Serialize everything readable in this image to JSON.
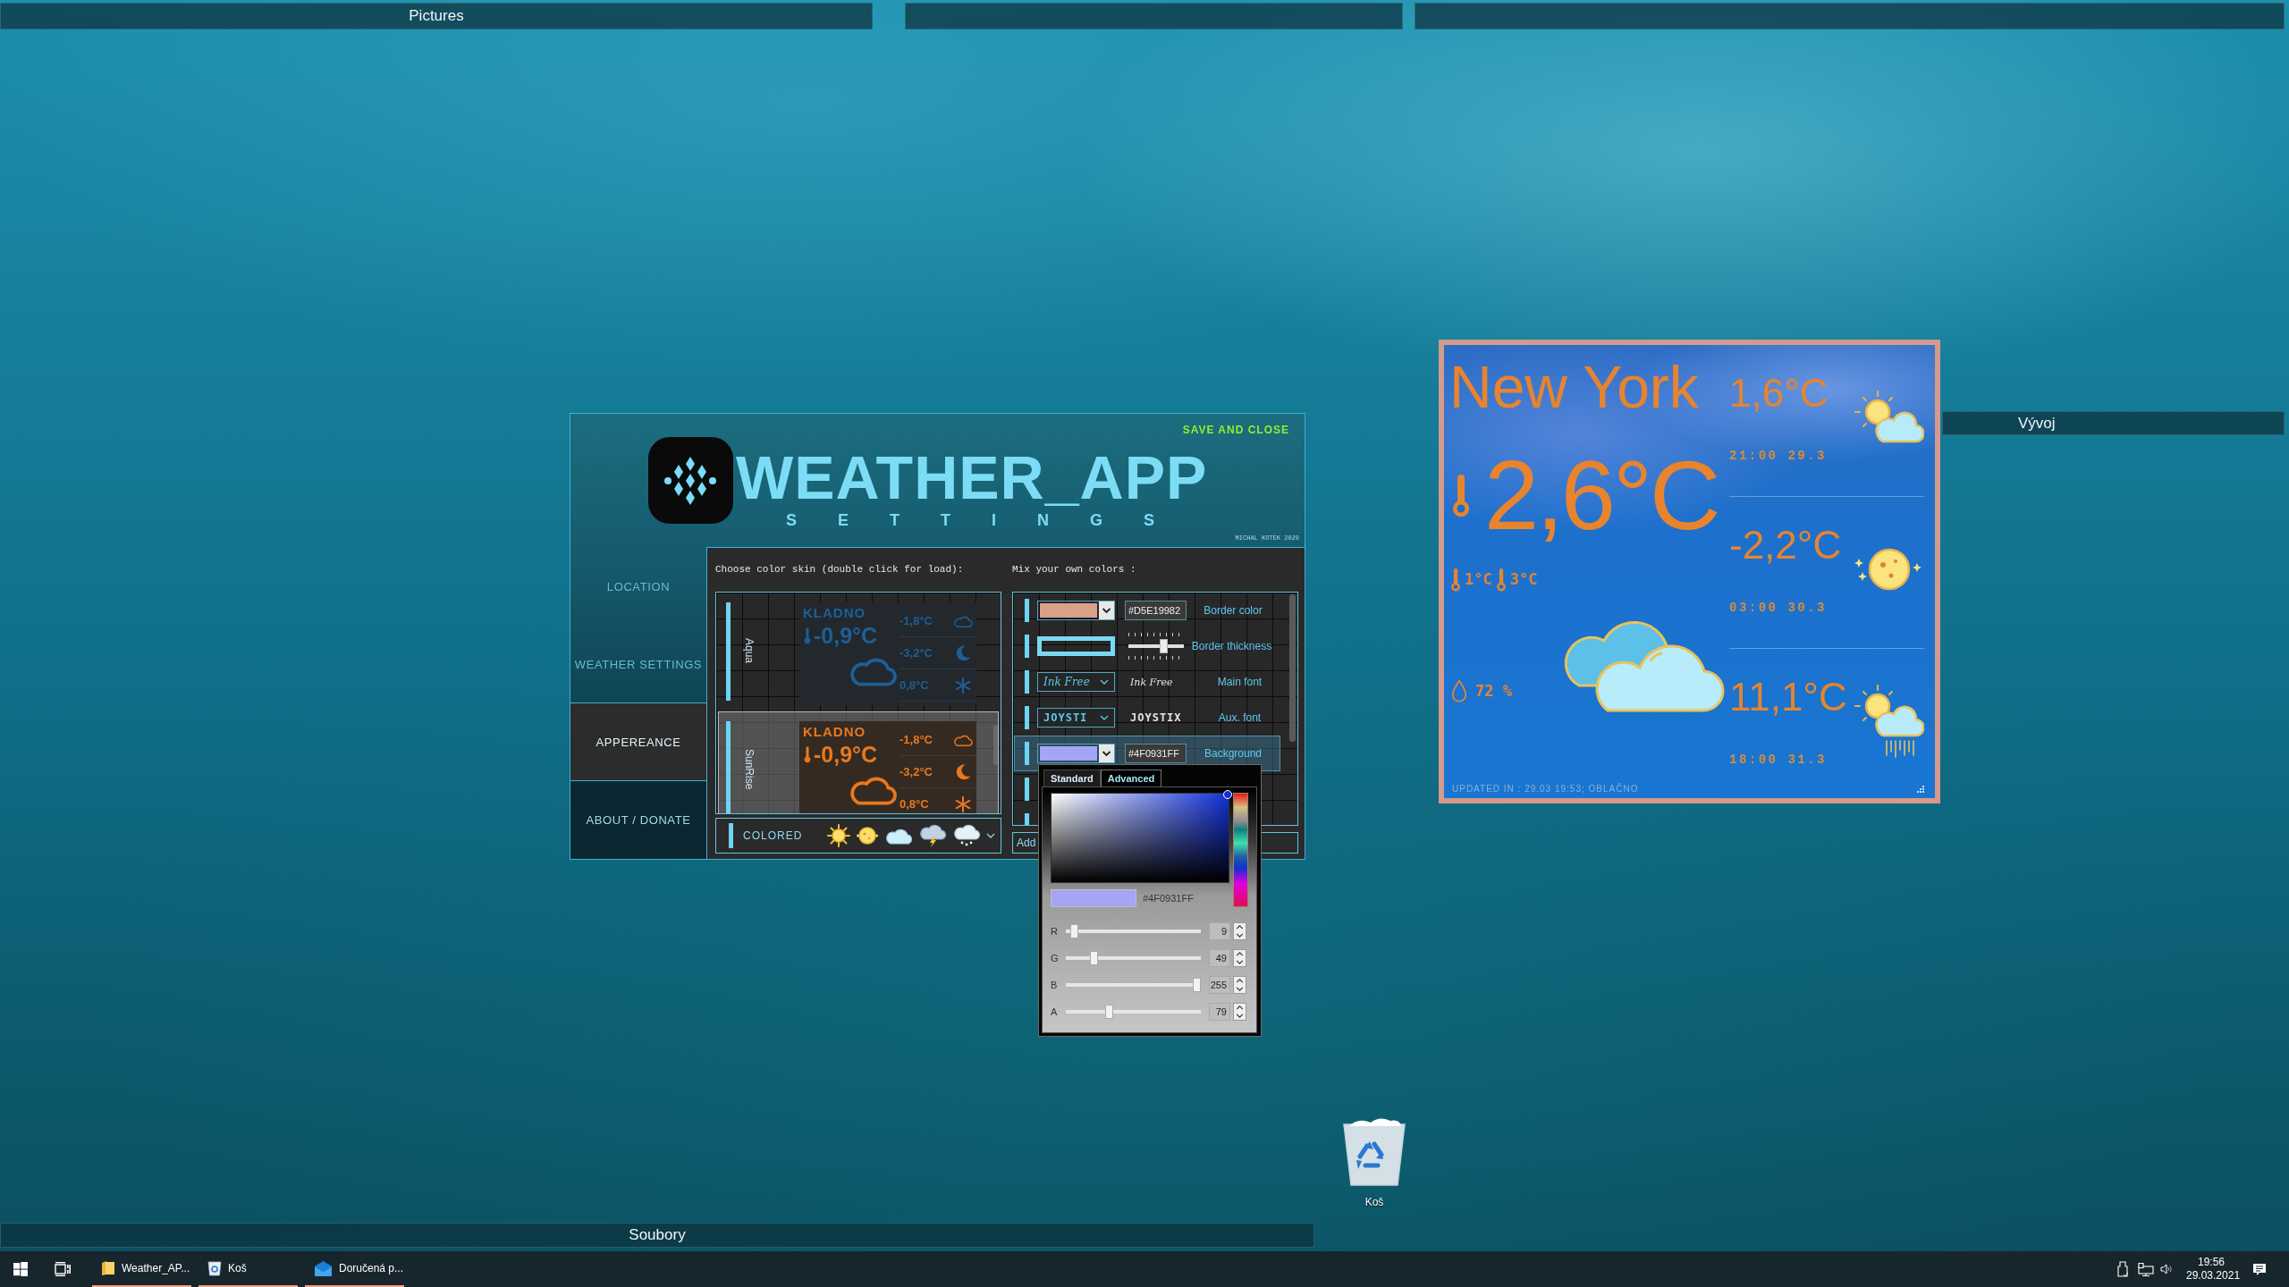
{
  "top_fences": [
    {
      "kind": "titled",
      "title": "Pictures"
    },
    {
      "kind": "untitled"
    },
    {
      "kind": "untitled"
    }
  ],
  "settings_window": {
    "title": "WEATHER_APP",
    "subtitle": "SETTINGS",
    "save_button": "SAVE AND CLOSE",
    "credit": "MICHAL KOTEK 2020",
    "nav": [
      {
        "label": "LOCATION",
        "selected": false,
        "hovered": false
      },
      {
        "label": "WEATHER SETTINGS",
        "selected": false,
        "hovered": false
      },
      {
        "label": "APPEREANCE",
        "selected": true,
        "hovered": false
      },
      {
        "label": "ABOUT / DONATE",
        "selected": false,
        "hovered": true
      }
    ],
    "skins": {
      "heading": "Choose color skin (double click for load):",
      "items": [
        {
          "name": "Aqua",
          "selected": false,
          "color": "#1d5f96",
          "city": "KLADNO",
          "temp": "-0,9°C",
          "forecast": [
            {
              "kind": "cloud",
              "temp": "-1,8°C"
            },
            {
              "kind": "moon",
              "temp": "-3,2°C"
            },
            {
              "kind": "snow",
              "temp": "0,8°C"
            }
          ]
        },
        {
          "name": "SunRise",
          "selected": true,
          "color": "#e8781c",
          "city": "KLADNO",
          "temp": "-0,9°C",
          "forecast": [
            {
              "kind": "cloud",
              "temp": "-1,8°C"
            },
            {
              "kind": "moon",
              "temp": "-3,2°C"
            },
            {
              "kind": "snow",
              "temp": "0,8°C"
            }
          ]
        }
      ]
    },
    "icon_set": {
      "label": "COLORED"
    },
    "mixer": {
      "heading": "Mix your own colors :",
      "rows": [
        {
          "kind": "color",
          "selected": false,
          "color": "#d9a08a",
          "value": "#D5E19982",
          "label": "Border color"
        },
        {
          "kind": "thickness",
          "selected": false,
          "level": 0.66,
          "label": "Border thickness"
        },
        {
          "kind": "font",
          "selected": false,
          "value": "Ink Free",
          "preview": "Ink Free",
          "label": "Main font"
        },
        {
          "kind": "font",
          "selected": false,
          "value": "JOYSTI",
          "preview": "JOYSTIX",
          "label": "Aux. font"
        },
        {
          "kind": "color",
          "selected": true,
          "color": "#a3a6f2",
          "value": "#4F0931FF",
          "label": "Background"
        },
        {
          "kind": "covered",
          "selected": false
        },
        {
          "kind": "covered",
          "selected": false
        }
      ],
      "add_button": "Add"
    },
    "color_picker": {
      "tabs": [
        {
          "label": "Standard",
          "selected": false
        },
        {
          "label": "Advanced",
          "selected": true
        }
      ],
      "hex": "#4F0931FF",
      "channels": [
        {
          "name": "R",
          "value": "9",
          "level": 0.035
        },
        {
          "name": "G",
          "value": "49",
          "level": 0.19
        },
        {
          "name": "B",
          "value": "255",
          "level": 1
        },
        {
          "name": "A",
          "value": "79",
          "level": 0.31
        }
      ]
    }
  },
  "side_fence": {
    "title": "Vývoj"
  },
  "weather_widget": {
    "city": "New York",
    "temp": "2,6°C",
    "min": "1°C",
    "max": "3°C",
    "humidity": "72 %",
    "forecast": [
      {
        "kind": "partly-cloudy",
        "temp": "1,6°C",
        "time": "21:00 29.3"
      },
      {
        "kind": "clear-night",
        "temp": "-2,2°C",
        "time": "03:00 30.3"
      },
      {
        "kind": "rain",
        "temp": "11,1°C",
        "time": "18:00 31.3"
      }
    ],
    "updated": "UPDATED IN : 29.03 19:53; OBLAČNO"
  },
  "recycle_bin": {
    "label": "Koš"
  },
  "bottom_fence": {
    "title": "Soubory"
  },
  "taskbar": {
    "apps": [
      {
        "kind": "folder",
        "label": "Weather_AP...",
        "running": true
      },
      {
        "kind": "recycle-bin",
        "label": "Koš",
        "running": true
      },
      {
        "kind": "mail",
        "label": "Doručená p...",
        "running": true
      }
    ],
    "time": "19:56",
    "date": "29.03.2021"
  }
}
